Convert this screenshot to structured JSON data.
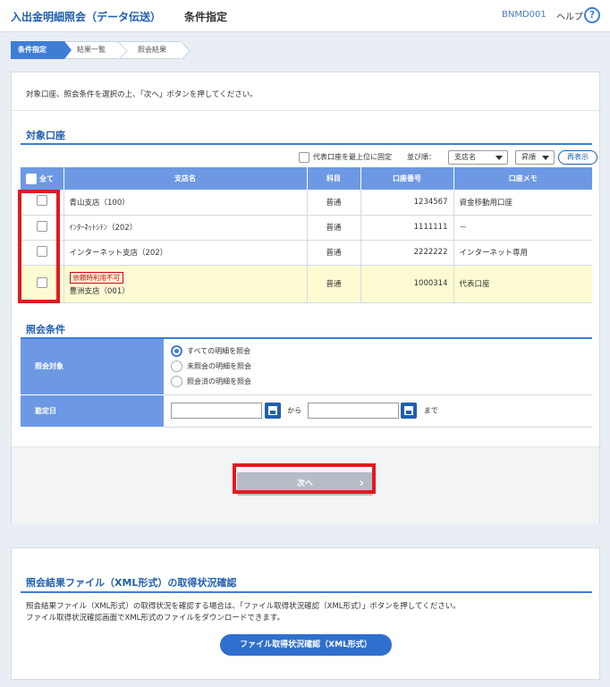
{
  "header": {
    "app_title": "入出金明細照会（データ伝送）",
    "page_title": "条件指定",
    "screen_id": "BNMD001",
    "help_label": "ヘルプ",
    "help_icon": "?"
  },
  "steps": [
    {
      "label": "条件指定",
      "active": true
    },
    {
      "label": "結果一覧",
      "active": false
    },
    {
      "label": "照会結果",
      "active": false
    }
  ],
  "instruction": "対象口座、照会条件を選択の上、「次へ」ボタンを押してください。",
  "accounts_section": {
    "title": "対象口座",
    "fix_label": "代表口座を最上位に固定",
    "sort_label": "並び順：",
    "sort_key": "支店名",
    "sort_order": "昇順",
    "redisplay": "再表示",
    "columns": {
      "all": "全て",
      "branch": "支店名",
      "subject": "科目",
      "number": "口座番号",
      "memo": "口座メモ"
    },
    "rows": [
      {
        "branch": "青山支店（100）",
        "subject": "普通",
        "number": "1234567",
        "memo": "資金移動用口座",
        "badge": ""
      },
      {
        "branch": "ｲﾝﾀｰﾈｯﾄｼﾃﾝ（202）",
        "subject": "普通",
        "number": "1111111",
        "memo": "－",
        "badge": ""
      },
      {
        "branch": "インターネット支店（202）",
        "subject": "普通",
        "number": "2222222",
        "memo": "インターネット専用",
        "badge": ""
      },
      {
        "branch": "豊洲支店（001）",
        "subject": "普通",
        "number": "1000314",
        "memo": "代表口座",
        "badge": "依頼時利用不可"
      }
    ]
  },
  "conditions_section": {
    "title": "照会条件",
    "target_label": "照会対象",
    "options": [
      "すべての明細を照会",
      "未照会の明細を照会",
      "照会済の明細を照会"
    ],
    "selected_option": 0,
    "date_label": "勘定日",
    "from_label": "から",
    "to_label": "まで"
  },
  "next_button": "次へ",
  "file_section": {
    "title": "照会結果ファイル（XML形式）の取得状況確認",
    "text1": "照会結果ファイル（XML形式）の取得状況を確認する場合は、「ファイル取得状況確認（XML形式）」ボタンを押してください。",
    "text2": "ファイル取得状況確認画面でXML形式のファイルをダウンロードできます。",
    "button": "ファイル取得状況確認（XML形式）"
  },
  "colors": {
    "accent": "#3e7dd6",
    "header_text": "#1f5fae",
    "highlight_red": "#e01a22"
  }
}
